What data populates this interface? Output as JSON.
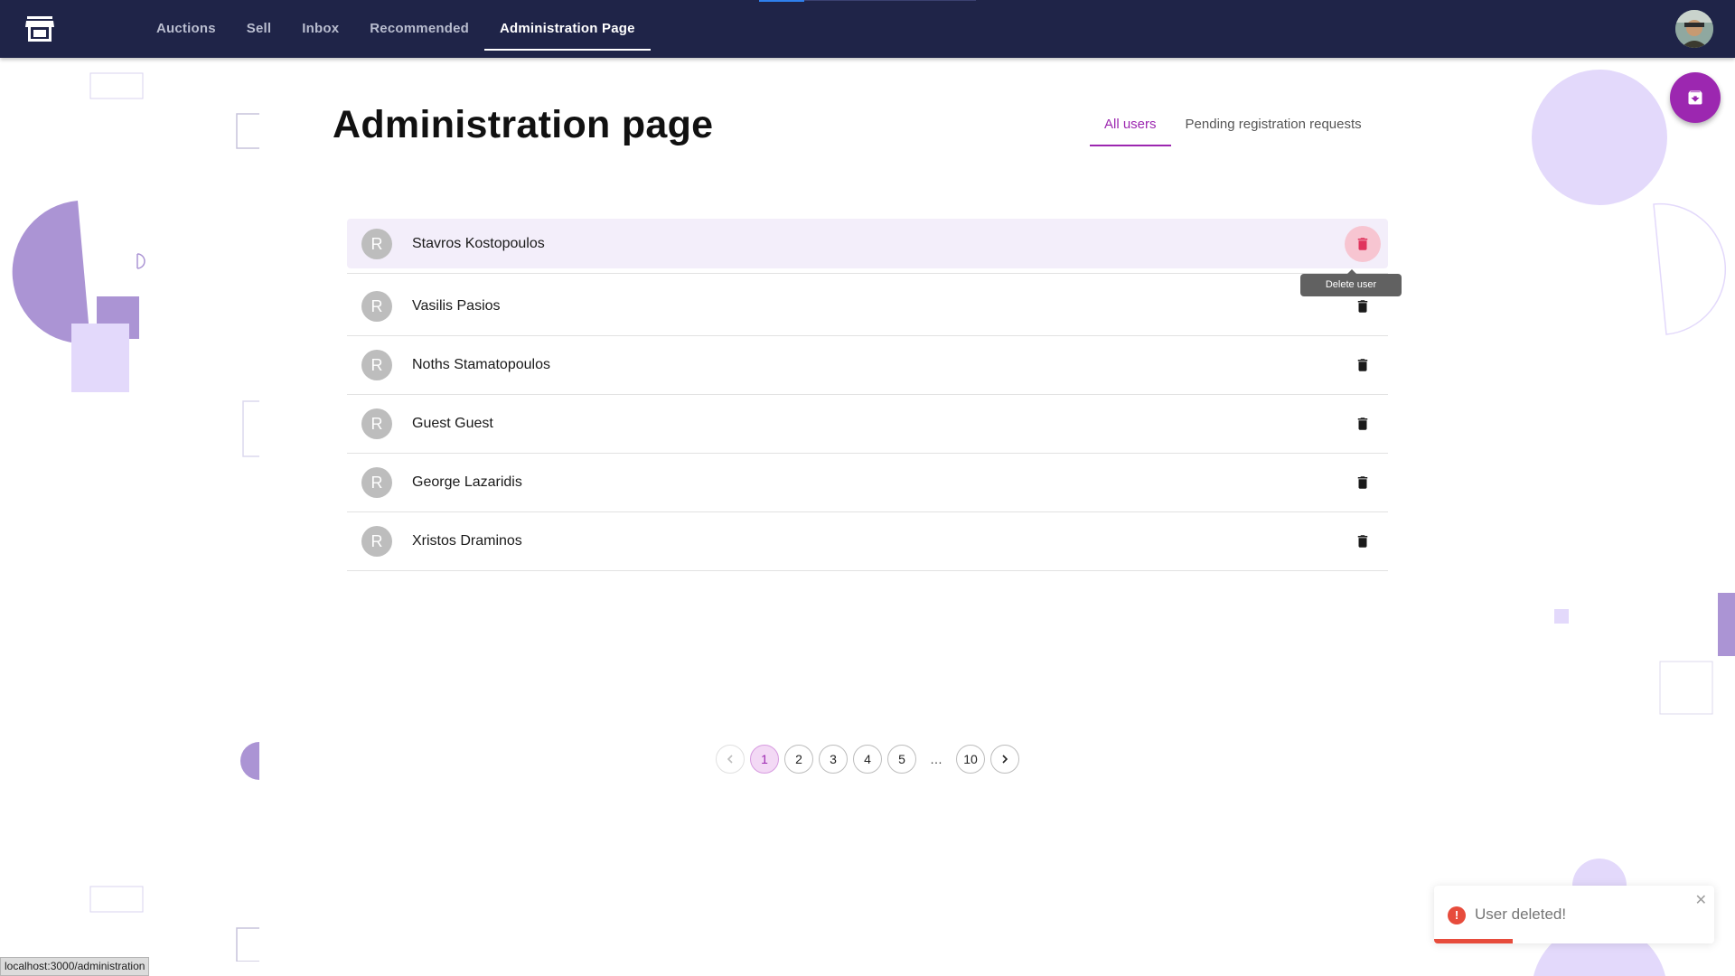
{
  "nav": {
    "links": [
      "Auctions",
      "Sell",
      "Inbox",
      "Recommended",
      "Administration Page"
    ],
    "active_link": "Administration Page"
  },
  "page": {
    "title": "Administration page"
  },
  "tabs": [
    {
      "label": "All users",
      "active": true
    },
    {
      "label": "Pending registration requests",
      "active": false
    }
  ],
  "users": [
    {
      "initial": "R",
      "name": "Stavros Kostopoulos"
    },
    {
      "initial": "R",
      "name": "Vasilis Pasios"
    },
    {
      "initial": "R",
      "name": "Noths Stamatopoulos"
    },
    {
      "initial": "R",
      "name": "Guest Guest"
    },
    {
      "initial": "R",
      "name": "George Lazaridis"
    },
    {
      "initial": "R",
      "name": "Xristos Draminos"
    }
  ],
  "tooltip": {
    "text": "Delete user"
  },
  "pagination": {
    "pages": [
      "1",
      "2",
      "3",
      "4",
      "5"
    ],
    "ellipsis": "…",
    "last_page": "10",
    "current": "1"
  },
  "toast": {
    "message": "User deleted!",
    "remaining_fraction": 0.28
  },
  "statusbar": {
    "url": "localhost:3000/administration"
  },
  "icons": {
    "logo": "storefront-icon",
    "avatar": "user-avatar-photo",
    "delete": "trash-icon",
    "fab": "archive-download-icon",
    "toast": "error-icon",
    "close": "close-icon",
    "prev": "chevron-left-icon",
    "next": "chevron-right-icon"
  },
  "colors": {
    "nav_bg": "#1f2448",
    "accent": "#9c27b0",
    "hover_row": "#f3eefa",
    "delete_hover": "#f7c5d1",
    "error": "#e74c3c",
    "deco_purple": "#ab94d4",
    "deco_light": "#e3d9fb"
  }
}
